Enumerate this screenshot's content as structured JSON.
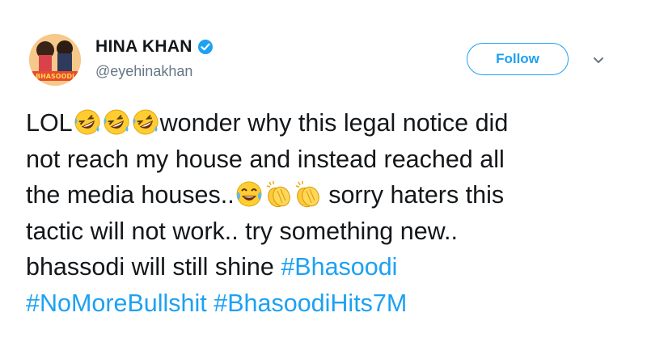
{
  "user": {
    "display_name": "HINA KHAN",
    "handle": "@eyehinakhan",
    "avatar_caption": "BHASOODI",
    "verified": true
  },
  "actions": {
    "follow_label": "Follow"
  },
  "tweet": {
    "line1_prefix": "LOL",
    "line1_suffix": "wonder why this legal notice did",
    "line2": "not reach my house and instead reached all",
    "line3_prefix": "the media houses..",
    "line3_suffix": " sorry haters this",
    "line4": "tactic will not work.. try something new..",
    "line5_text": "bhassodi will still shine ",
    "hashtags": [
      "#Bhasoodi",
      "#NoMoreBullshit",
      "#BhasoodiHits7M"
    ]
  },
  "icons": {
    "verified": "verified-badge-icon",
    "caret": "chevron-down-icon",
    "emoji_rofl": "rolling-on-floor-laughing-emoji",
    "emoji_joy": "face-with-tears-of-joy-emoji",
    "emoji_clap": "clapping-hands-emoji"
  },
  "colors": {
    "brand_blue": "#1da1f2",
    "text": "#14171a",
    "secondary_text": "#657786"
  }
}
